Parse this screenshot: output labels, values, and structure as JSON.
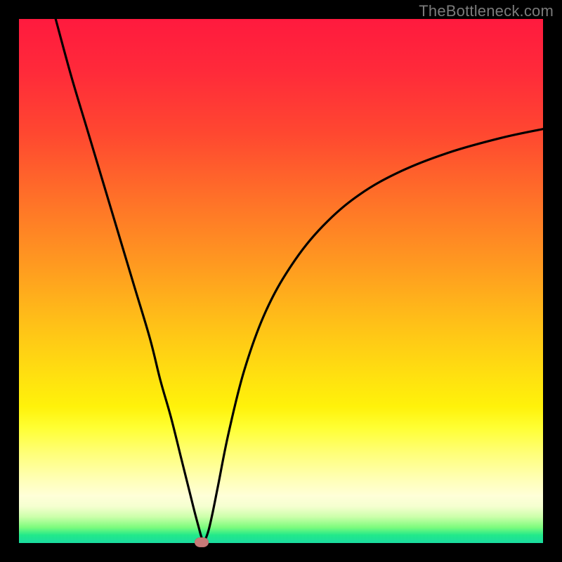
{
  "watermark": "TheBottleneck.com",
  "colors": {
    "frame": "#000000",
    "curve": "#000000",
    "marker": "#c77a78"
  },
  "chart_data": {
    "type": "line",
    "title": "",
    "xlabel": "",
    "ylabel": "",
    "xlim": [
      0,
      100
    ],
    "ylim": [
      0,
      100
    ],
    "series": [
      {
        "name": "curve",
        "x": [
          7.0,
          10,
          13,
          16,
          19,
          22,
          25,
          27,
          29,
          31,
          32.5,
          33.5,
          34.3,
          34.8,
          35.2,
          35.6,
          36.2,
          37.0,
          38.0,
          40,
          43,
          47,
          52,
          58,
          65,
          73,
          82,
          92,
          100
        ],
        "y": [
          100,
          89,
          79,
          69,
          59,
          49,
          39,
          31,
          24,
          16,
          10,
          6,
          3,
          1.2,
          0.3,
          0.8,
          2.5,
          6,
          11,
          21,
          33,
          44,
          53,
          60.5,
          66.5,
          71,
          74.5,
          77.3,
          79
        ]
      }
    ],
    "marker": {
      "x": 34.8,
      "y": 0.2
    },
    "grid": false
  }
}
